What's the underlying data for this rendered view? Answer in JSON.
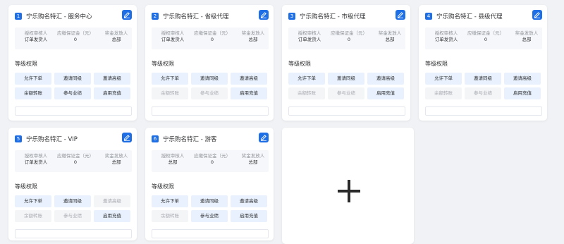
{
  "cards": [
    {
      "number": "1",
      "title": "宁乐购名特汇 - 服务中心",
      "info": {
        "labels": [
          "授权审核人",
          "应缴保证金（元）",
          "奖金发放人"
        ],
        "row1": [
          "订单发货人",
          "0",
          "总部"
        ]
      },
      "permissions_title": "等级权限",
      "permissions": [
        {
          "label": "允许下单",
          "enabled": true
        },
        {
          "label": "邀请同级",
          "enabled": true
        },
        {
          "label": "邀请高级",
          "enabled": true
        },
        {
          "label": "余额转账",
          "enabled": true
        },
        {
          "label": "参与业绩",
          "enabled": true
        },
        {
          "label": "启用充值",
          "enabled": true
        }
      ]
    },
    {
      "number": "2",
      "title": "宁乐购名特汇 - 省级代理",
      "info": {
        "labels": [
          "授权审核人",
          "应缴保证金（元）",
          "奖金发放人"
        ],
        "row1": [
          "订单发货人",
          "0",
          "总部"
        ]
      },
      "permissions_title": "等级权限",
      "permissions": [
        {
          "label": "允许下单",
          "enabled": true
        },
        {
          "label": "邀请同级",
          "enabled": true
        },
        {
          "label": "邀请高级",
          "enabled": true
        },
        {
          "label": "余额转账",
          "enabled": false
        },
        {
          "label": "参与业绩",
          "enabled": false
        },
        {
          "label": "启用充值",
          "enabled": true
        }
      ]
    },
    {
      "number": "3",
      "title": "宁乐购名特汇 - 市级代理",
      "info": {
        "labels": [
          "授权审核人",
          "应缴保证金（元）",
          "奖金发放人"
        ],
        "row1": [
          "订单发货人",
          "0",
          "总部"
        ]
      },
      "permissions_title": "等级权限",
      "permissions": [
        {
          "label": "允许下单",
          "enabled": true
        },
        {
          "label": "邀请同级",
          "enabled": true
        },
        {
          "label": "邀请高级",
          "enabled": true
        },
        {
          "label": "余额转账",
          "enabled": false
        },
        {
          "label": "参与业绩",
          "enabled": false
        },
        {
          "label": "启用充值",
          "enabled": true
        }
      ]
    },
    {
      "number": "4",
      "title": "宁乐购名特汇 - 县级代理",
      "info": {
        "labels": [
          "授权审核人",
          "应缴保证金（元）",
          "奖金发放人"
        ],
        "row1": [
          "订单发货人",
          "0",
          "总部"
        ]
      },
      "permissions_title": "等级权限",
      "permissions": [
        {
          "label": "允许下单",
          "enabled": true
        },
        {
          "label": "邀请同级",
          "enabled": true
        },
        {
          "label": "邀请高级",
          "enabled": true
        },
        {
          "label": "余额转账",
          "enabled": false
        },
        {
          "label": "参与业绩",
          "enabled": false
        },
        {
          "label": "启用充值",
          "enabled": true
        }
      ]
    },
    {
      "number": "5",
      "title": "宁乐购名特汇 - VIP",
      "info": {
        "labels": [
          "授权审核人",
          "应缴保证金（元）",
          "奖金发放人"
        ],
        "row1": [
          "订单发货人",
          "0",
          "总部"
        ]
      },
      "permissions_title": "等级权限",
      "permissions": [
        {
          "label": "允许下单",
          "enabled": true
        },
        {
          "label": "邀请同级",
          "enabled": true
        },
        {
          "label": "邀请高级",
          "enabled": false
        },
        {
          "label": "余额转账",
          "enabled": false
        },
        {
          "label": "参与业绩",
          "enabled": false
        },
        {
          "label": "启用充值",
          "enabled": true
        }
      ]
    },
    {
      "number": "6",
      "title": "宁乐购名特汇 - 游客",
      "info": {
        "labels": [
          "授权审核人",
          "应缴保证金（元）",
          "奖金发放人"
        ],
        "row1": [
          "总部",
          "0",
          "总部"
        ]
      },
      "permissions_title": "等级权限",
      "permissions": [
        {
          "label": "允许下单",
          "enabled": true
        },
        {
          "label": "邀请同级",
          "enabled": true
        },
        {
          "label": "邀请高级",
          "enabled": true
        },
        {
          "label": "余额转账",
          "enabled": false
        },
        {
          "label": "参与业绩",
          "enabled": true
        },
        {
          "label": "启用充值",
          "enabled": true
        }
      ]
    }
  ],
  "add_card": {
    "icon": "plus-icon"
  },
  "colors": {
    "accent": "#1e6fe6",
    "enabled_bg": "#e8f1fd",
    "disabled_bg": "#f4f5f7",
    "page_bg": "#f0f2f5"
  }
}
